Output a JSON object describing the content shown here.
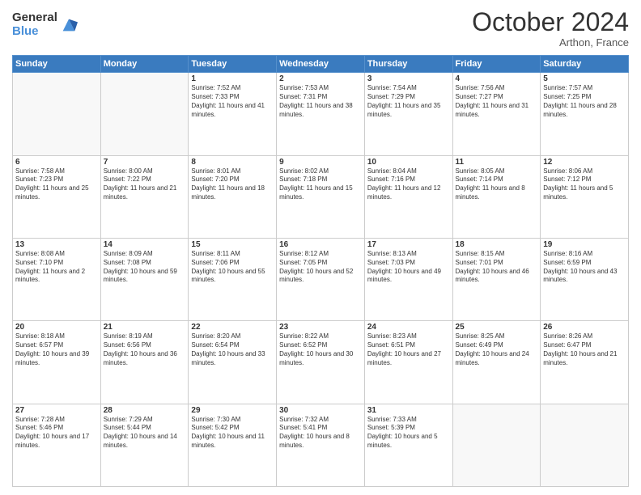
{
  "logo": {
    "general": "General",
    "blue": "Blue"
  },
  "title": "October 2024",
  "location": "Arthon, France",
  "days_of_week": [
    "Sunday",
    "Monday",
    "Tuesday",
    "Wednesday",
    "Thursday",
    "Friday",
    "Saturday"
  ],
  "weeks": [
    [
      {
        "day": "",
        "info": ""
      },
      {
        "day": "",
        "info": ""
      },
      {
        "day": "1",
        "info": "Sunrise: 7:52 AM\nSunset: 7:33 PM\nDaylight: 11 hours and 41 minutes."
      },
      {
        "day": "2",
        "info": "Sunrise: 7:53 AM\nSunset: 7:31 PM\nDaylight: 11 hours and 38 minutes."
      },
      {
        "day": "3",
        "info": "Sunrise: 7:54 AM\nSunset: 7:29 PM\nDaylight: 11 hours and 35 minutes."
      },
      {
        "day": "4",
        "info": "Sunrise: 7:56 AM\nSunset: 7:27 PM\nDaylight: 11 hours and 31 minutes."
      },
      {
        "day": "5",
        "info": "Sunrise: 7:57 AM\nSunset: 7:25 PM\nDaylight: 11 hours and 28 minutes."
      }
    ],
    [
      {
        "day": "6",
        "info": "Sunrise: 7:58 AM\nSunset: 7:23 PM\nDaylight: 11 hours and 25 minutes."
      },
      {
        "day": "7",
        "info": "Sunrise: 8:00 AM\nSunset: 7:22 PM\nDaylight: 11 hours and 21 minutes."
      },
      {
        "day": "8",
        "info": "Sunrise: 8:01 AM\nSunset: 7:20 PM\nDaylight: 11 hours and 18 minutes."
      },
      {
        "day": "9",
        "info": "Sunrise: 8:02 AM\nSunset: 7:18 PM\nDaylight: 11 hours and 15 minutes."
      },
      {
        "day": "10",
        "info": "Sunrise: 8:04 AM\nSunset: 7:16 PM\nDaylight: 11 hours and 12 minutes."
      },
      {
        "day": "11",
        "info": "Sunrise: 8:05 AM\nSunset: 7:14 PM\nDaylight: 11 hours and 8 minutes."
      },
      {
        "day": "12",
        "info": "Sunrise: 8:06 AM\nSunset: 7:12 PM\nDaylight: 11 hours and 5 minutes."
      }
    ],
    [
      {
        "day": "13",
        "info": "Sunrise: 8:08 AM\nSunset: 7:10 PM\nDaylight: 11 hours and 2 minutes."
      },
      {
        "day": "14",
        "info": "Sunrise: 8:09 AM\nSunset: 7:08 PM\nDaylight: 10 hours and 59 minutes."
      },
      {
        "day": "15",
        "info": "Sunrise: 8:11 AM\nSunset: 7:06 PM\nDaylight: 10 hours and 55 minutes."
      },
      {
        "day": "16",
        "info": "Sunrise: 8:12 AM\nSunset: 7:05 PM\nDaylight: 10 hours and 52 minutes."
      },
      {
        "day": "17",
        "info": "Sunrise: 8:13 AM\nSunset: 7:03 PM\nDaylight: 10 hours and 49 minutes."
      },
      {
        "day": "18",
        "info": "Sunrise: 8:15 AM\nSunset: 7:01 PM\nDaylight: 10 hours and 46 minutes."
      },
      {
        "day": "19",
        "info": "Sunrise: 8:16 AM\nSunset: 6:59 PM\nDaylight: 10 hours and 43 minutes."
      }
    ],
    [
      {
        "day": "20",
        "info": "Sunrise: 8:18 AM\nSunset: 6:57 PM\nDaylight: 10 hours and 39 minutes."
      },
      {
        "day": "21",
        "info": "Sunrise: 8:19 AM\nSunset: 6:56 PM\nDaylight: 10 hours and 36 minutes."
      },
      {
        "day": "22",
        "info": "Sunrise: 8:20 AM\nSunset: 6:54 PM\nDaylight: 10 hours and 33 minutes."
      },
      {
        "day": "23",
        "info": "Sunrise: 8:22 AM\nSunset: 6:52 PM\nDaylight: 10 hours and 30 minutes."
      },
      {
        "day": "24",
        "info": "Sunrise: 8:23 AM\nSunset: 6:51 PM\nDaylight: 10 hours and 27 minutes."
      },
      {
        "day": "25",
        "info": "Sunrise: 8:25 AM\nSunset: 6:49 PM\nDaylight: 10 hours and 24 minutes."
      },
      {
        "day": "26",
        "info": "Sunrise: 8:26 AM\nSunset: 6:47 PM\nDaylight: 10 hours and 21 minutes."
      }
    ],
    [
      {
        "day": "27",
        "info": "Sunrise: 7:28 AM\nSunset: 5:46 PM\nDaylight: 10 hours and 17 minutes."
      },
      {
        "day": "28",
        "info": "Sunrise: 7:29 AM\nSunset: 5:44 PM\nDaylight: 10 hours and 14 minutes."
      },
      {
        "day": "29",
        "info": "Sunrise: 7:30 AM\nSunset: 5:42 PM\nDaylight: 10 hours and 11 minutes."
      },
      {
        "day": "30",
        "info": "Sunrise: 7:32 AM\nSunset: 5:41 PM\nDaylight: 10 hours and 8 minutes."
      },
      {
        "day": "31",
        "info": "Sunrise: 7:33 AM\nSunset: 5:39 PM\nDaylight: 10 hours and 5 minutes."
      },
      {
        "day": "",
        "info": ""
      },
      {
        "day": "",
        "info": ""
      }
    ]
  ]
}
